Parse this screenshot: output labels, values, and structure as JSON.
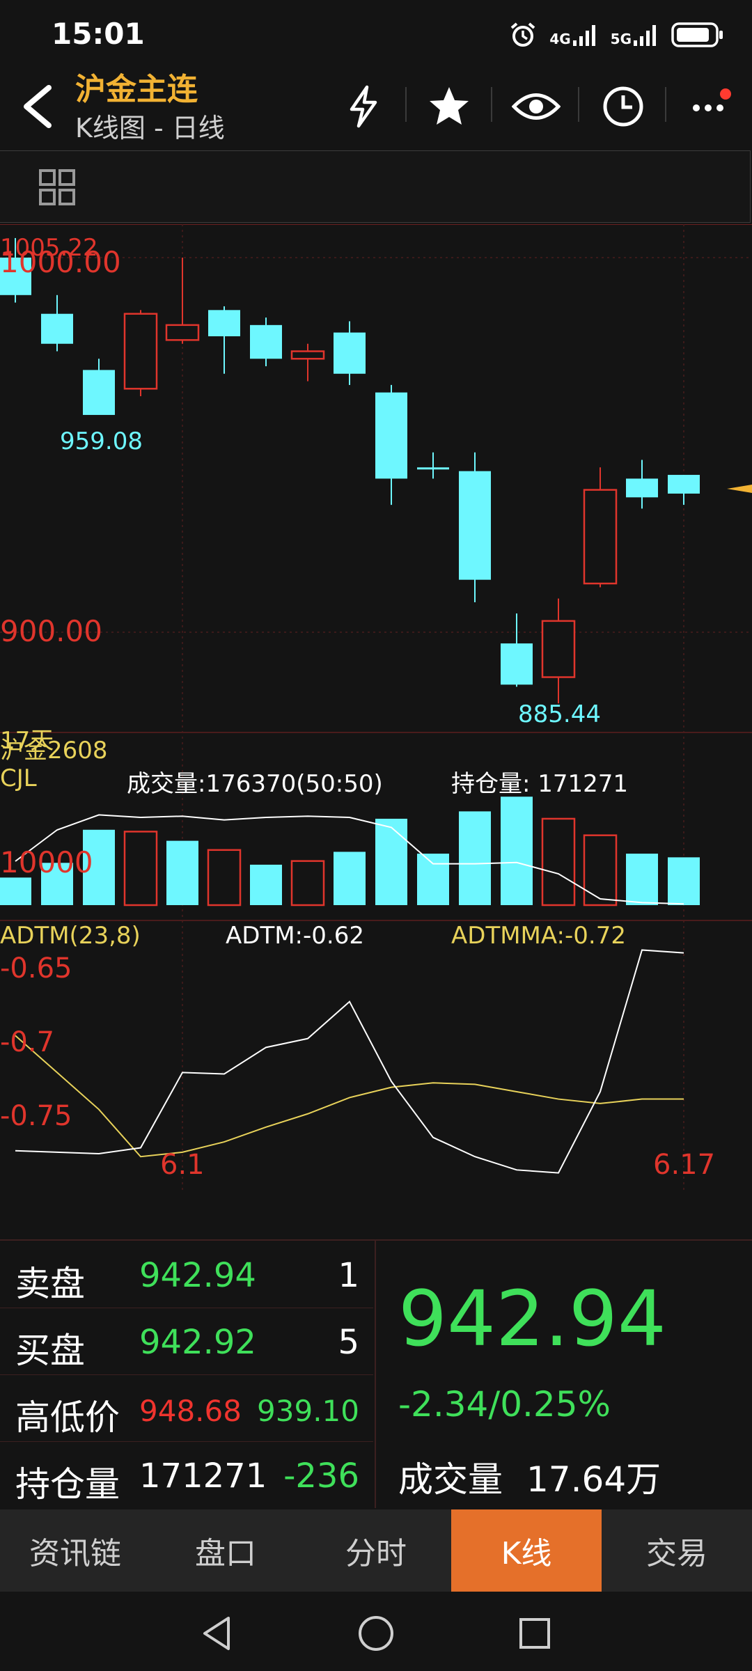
{
  "status_bar": {
    "time": "15:01",
    "network_1": "4G",
    "network_2": "5G",
    "icons": [
      "alarm-icon",
      "signal-4g-icon",
      "signal-5g-icon",
      "battery-icon"
    ]
  },
  "header": {
    "title": "沪金主连",
    "subtitle": "K线图 - 日线",
    "icons": [
      "lightning-icon",
      "star-icon",
      "eye-icon",
      "clock-icon",
      "more-icon"
    ],
    "accent_color": "#f2b233",
    "notification_dot_color": "#ff3b30"
  },
  "toolbar": {
    "icon": "grid-icon"
  },
  "chart": {
    "price_labels": {
      "top_overlap_a": "1005.22",
      "top_overlap_b": "1000.00",
      "mid": "900.00",
      "high_marker": "959.08",
      "low_marker": "885.44"
    },
    "overlay_text": "17天",
    "contract_label": "沪金2608",
    "volume_panel": {
      "name": "CJL",
      "volume_label": "成交量:176370(50:50)",
      "open_interest_label": "持仓量: 171271",
      "scale_label": "10000"
    },
    "adtm_panel": {
      "name": "ADTM(23,8)",
      "adtm_label": "ADTM:-0.62",
      "adtmma_label": "ADTMMA:-0.72",
      "y_labels": [
        "-0.65",
        "-0.7",
        "-0.75"
      ]
    },
    "date_labels": [
      "6.1",
      "6.17"
    ],
    "colors": {
      "up": "#e0352c",
      "down": "#6ef7ff",
      "axis_text": "#e0352c",
      "adtm_line": "#ffffff",
      "adtmma_line": "#e8d25a",
      "volume_label": "#ffffff",
      "grid": "#4a1c1c"
    }
  },
  "chart_data": [
    {
      "type": "candlestick",
      "title": "",
      "y_axis_ticks": [
        "1000.00",
        "900.00"
      ],
      "x_axis_ticks": [
        "6.1",
        "6.17"
      ],
      "candles": [
        {
          "open": 1000,
          "close": 990,
          "high": 1005.22,
          "low": 988
        },
        {
          "open": 985,
          "close": 977,
          "high": 990,
          "low": 975
        },
        {
          "open": 970,
          "close": 958,
          "high": 973,
          "low": 959.08
        },
        {
          "open": 965,
          "close": 985,
          "high": 986,
          "low": 963
        },
        {
          "open": 978,
          "close": 982,
          "high": 1000,
          "low": 977
        },
        {
          "open": 986,
          "close": 979,
          "high": 987,
          "low": 969
        },
        {
          "open": 982,
          "close": 973,
          "high": 984,
          "low": 971
        },
        {
          "open": 973,
          "close": 975,
          "high": 977,
          "low": 967
        },
        {
          "open": 980,
          "close": 969,
          "high": 983,
          "low": 966
        },
        {
          "open": 964,
          "close": 941,
          "high": 966,
          "low": 934
        },
        {
          "open": 944,
          "close": 944,
          "high": 948,
          "low": 941
        },
        {
          "open": 943,
          "close": 914,
          "high": 948,
          "low": 908
        },
        {
          "open": 897,
          "close": 886,
          "high": 905,
          "low": 885.44
        },
        {
          "open": 888,
          "close": 903,
          "high": 909,
          "low": 881
        },
        {
          "open": 913,
          "close": 938,
          "high": 944,
          "low": 912
        },
        {
          "open": 941,
          "close": 936,
          "high": 946,
          "low": 933
        },
        {
          "open": 942,
          "close": 937,
          "high": 942,
          "low": 934
        }
      ]
    },
    {
      "type": "bar",
      "title": "CJL",
      "values": [
        150000,
        230000,
        410000,
        400000,
        350000,
        300000,
        220000,
        240000,
        290000,
        470000,
        280000,
        510000,
        590000,
        470000,
        380000,
        280000,
        260000
      ],
      "directions": [
        "down",
        "down",
        "down",
        "up",
        "down",
        "up",
        "down",
        "up",
        "down",
        "down",
        "down",
        "down",
        "down",
        "up",
        "up",
        "down",
        "down"
      ],
      "open_interest_line": [
        0.35,
        0.6,
        0.72,
        0.7,
        0.71,
        0.68,
        0.7,
        0.71,
        0.7,
        0.62,
        0.33,
        0.33,
        0.34,
        0.25,
        0.05,
        0.02,
        0.01
      ]
    },
    {
      "type": "line",
      "title": "ADTM(23,8)",
      "y_ticks": [
        -0.65,
        -0.7,
        -0.75
      ],
      "ylim": [
        -0.8,
        -0.63
      ],
      "series": [
        {
          "name": "ADTM",
          "values": [
            -0.773,
            -0.774,
            -0.775,
            -0.771,
            -0.72,
            -0.721,
            -0.703,
            -0.697,
            -0.672,
            -0.726,
            -0.764,
            -0.777,
            -0.786,
            -0.788,
            -0.733,
            -0.637,
            -0.639
          ]
        },
        {
          "name": "ADTMMA",
          "values": [
            -0.695,
            -0.72,
            -0.745,
            -0.777,
            -0.774,
            -0.767,
            -0.757,
            -0.748,
            -0.737,
            -0.73,
            -0.727,
            -0.728,
            -0.733,
            -0.738,
            -0.741,
            -0.738,
            -0.738
          ]
        }
      ]
    }
  ],
  "quote_panel": {
    "sell_label": "卖盘",
    "sell_price": "942.94",
    "sell_qty": "1",
    "buy_label": "买盘",
    "buy_price": "942.92",
    "buy_qty": "5",
    "hl_label": "高低价",
    "high_price": "948.68",
    "low_price": "939.10",
    "oi_label": "持仓量",
    "oi_value": "171271",
    "oi_change": "-236",
    "last_price": "942.94",
    "change": "-2.34/0.25%",
    "volume_label": "成交量",
    "volume_value": "17.64万"
  },
  "tabs": [
    {
      "label": "资讯链",
      "active": false
    },
    {
      "label": "盘口",
      "active": false
    },
    {
      "label": "分时",
      "active": false
    },
    {
      "label": "K线",
      "active": true
    },
    {
      "label": "交易",
      "active": false
    }
  ],
  "nav_bar": {
    "icons": [
      "back-triangle-icon",
      "home-circle-icon",
      "recents-square-icon"
    ]
  }
}
